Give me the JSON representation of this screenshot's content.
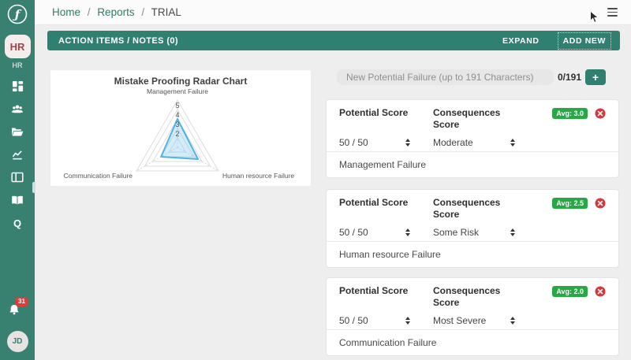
{
  "topbar": {
    "breadcrumb": {
      "home": "Home",
      "reports": "Reports",
      "current": "TRIAL",
      "separator": "/"
    }
  },
  "sidebar": {
    "org_badge": "HR",
    "org_label": "HR",
    "nav_icons": [
      "dashboard-icon",
      "users-icon",
      "folder-icon",
      "chart-line-icon",
      "panels-icon",
      "book-icon",
      "search-q-icon"
    ],
    "search_label": "Q",
    "notification_count": "31",
    "user_initials": "JD"
  },
  "action_bar": {
    "title": "ACTION ITEMS / NOTES (0)",
    "expand_label": "EXPAND",
    "add_new_label": "ADD NEW"
  },
  "new_failure": {
    "placeholder": "New Potential Failure (up to 191 Characters)",
    "counter": "0/191",
    "add_label": "+"
  },
  "cards": [
    {
      "potential_label": "Potential Score",
      "potential_value": "50 / 50",
      "consequences_label": "Consequences Score",
      "consequences_value": "Moderate",
      "avg_badge": "Avg: 3.0",
      "title": "Management Failure"
    },
    {
      "potential_label": "Potential Score",
      "potential_value": "50 / 50",
      "consequences_label": "Consequences Score",
      "consequences_value": "Some Risk",
      "avg_badge": "Avg: 2.5",
      "title": "Human resource Failure"
    },
    {
      "potential_label": "Potential Score",
      "potential_value": "50 / 50",
      "consequences_label": "Consequences Score",
      "consequences_value": "Most Severe",
      "avg_badge": "Avg: 2.0",
      "title": "Communication Failure"
    }
  ],
  "chart_data": {
    "type": "radar",
    "title": "Mistake Proofing Radar Chart",
    "categories": [
      "Management Failure",
      "Human resource Failure",
      "Communication Failure"
    ],
    "values": [
      3.0,
      2.5,
      2.0
    ],
    "scale": {
      "min": 0,
      "max": 5,
      "ticks": [
        2,
        3,
        4,
        5
      ]
    },
    "grid": true,
    "legend": "none",
    "series_color": "#4FB3E3",
    "fill_color": "rgba(130,201,240,0.35)"
  },
  "colors": {
    "sidebar_teal": "#388070",
    "action_bar_teal": "#2F8070",
    "badge_green": "#28A745",
    "delete_red": "#D7373F",
    "breadcrumb_link": "#2A7F6B"
  }
}
